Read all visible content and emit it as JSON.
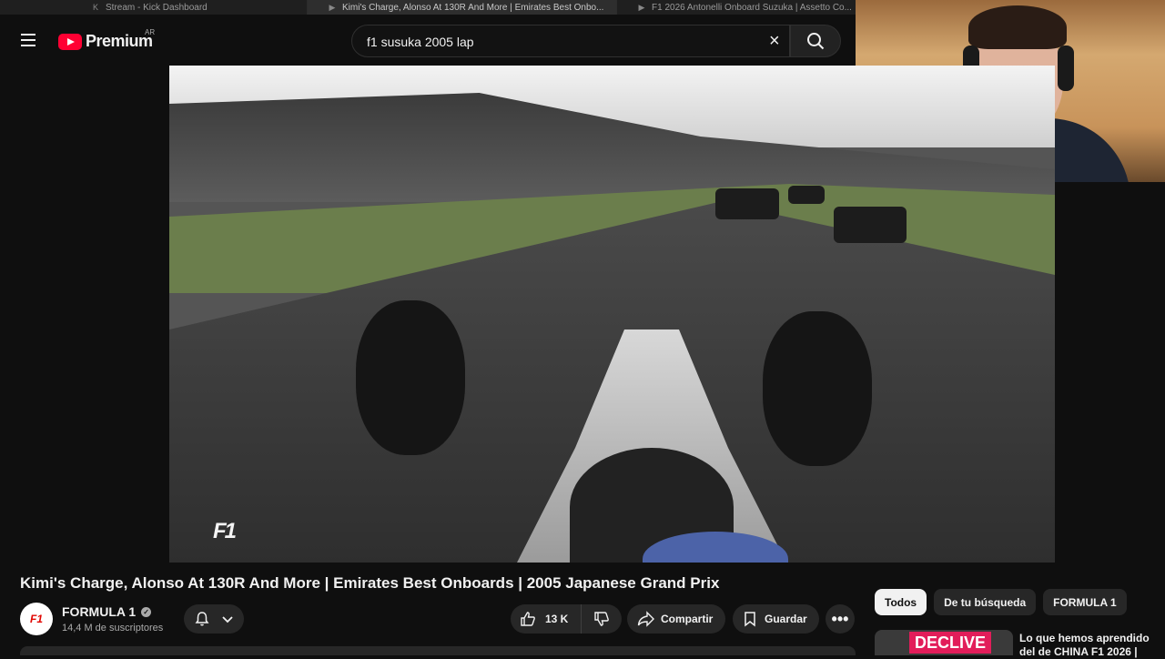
{
  "browser": {
    "tabs": [
      {
        "label": "Stream - Kick Dashboard",
        "icon": "kick-icon"
      },
      {
        "label": "Kimi's Charge, Alonso At 130R And More | Emirates Best Onbo...",
        "icon": "youtube-icon",
        "active": true
      },
      {
        "label": "F1 2026 Antonelli Onboard Suzuka | Assetto Co...",
        "icon": "youtube-icon"
      }
    ]
  },
  "header": {
    "logo_text": "Premium",
    "region": "AR",
    "search_value": "f1 susuka 2005 lap"
  },
  "video": {
    "title": "Kimi's Charge, Alonso At 130R And More | Emirates Best Onboards | 2005 Japanese Grand Prix",
    "overlay_logo": "F1"
  },
  "channel": {
    "avatar_text": "F1",
    "name": "FORMULA 1",
    "subscribers": "14,4 M de suscriptores"
  },
  "actions": {
    "likes": "13 K",
    "share_label": "Compartir",
    "save_label": "Guardar",
    "more_label": "•••"
  },
  "chips": [
    "Todos",
    "De tu búsqueda",
    "FORMULA 1"
  ],
  "recommendation": {
    "thumb_badge": "DECLIVE",
    "title": "Lo que hemos aprendido del de CHINA F1 2026 |"
  },
  "colors": {
    "background": "#0f0f0f",
    "brand_red": "#ff0033",
    "chip_bg": "#272727"
  }
}
